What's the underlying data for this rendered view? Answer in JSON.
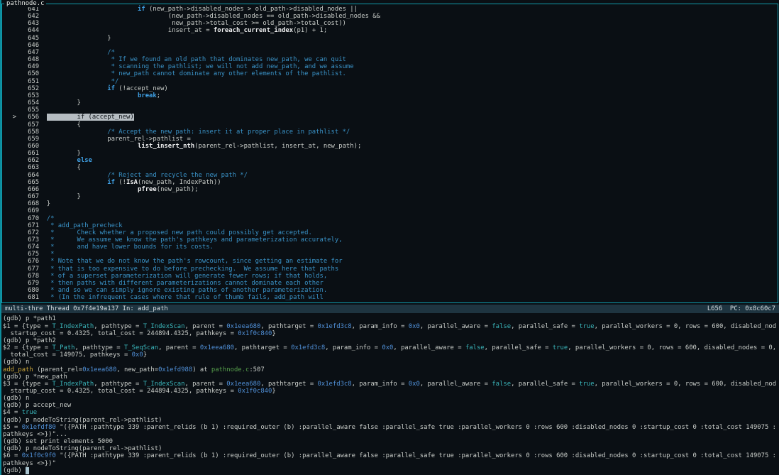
{
  "window": {
    "title": "pathnode.c"
  },
  "status": {
    "left": "multi-thre Thread 0x7f4e19a137 In: add_path",
    "right": "L656  PC: 0x8c60c7"
  },
  "colors": {
    "border_teal": "#109aab",
    "comment_blue": "#3a93c8",
    "keyword_blue": "#3fa0e4",
    "address_blue": "#5090d8",
    "enum_cyan": "#3ab5ba",
    "function_yellow": "#c9a43a",
    "filename_green": "#57a04c",
    "current_line_highlight_bg": "#b6bdc2",
    "status_bar_bg": "#1e3440",
    "cursor": "#a9c4d0"
  },
  "source": {
    "current_line": "656",
    "lines": [
      {
        "num": "641",
        "code": "                        if (new_path->disabled_nodes > old_path->disabled_nodes ||"
      },
      {
        "num": "642",
        "code": "                                (new_path->disabled_nodes == old_path->disabled_nodes &&"
      },
      {
        "num": "643",
        "code": "                                 new_path->total_cost >= old_path->total_cost))"
      },
      {
        "num": "644",
        "code": "                                insert_at = foreach_current_index(p1) + 1;"
      },
      {
        "num": "645",
        "code": "                }"
      },
      {
        "num": "646",
        "code": ""
      },
      {
        "num": "647",
        "code": "                /*",
        "comment": true
      },
      {
        "num": "648",
        "code": "                 * If we found an old path that dominates new_path, we can quit",
        "comment": true
      },
      {
        "num": "649",
        "code": "                 * scanning the pathlist; we will not add new_path, and we assume",
        "comment": true
      },
      {
        "num": "650",
        "code": "                 * new_path cannot dominate any other elements of the pathlist.",
        "comment": true
      },
      {
        "num": "651",
        "code": "                 */",
        "comment": true
      },
      {
        "num": "652",
        "code": "                if (!accept_new)"
      },
      {
        "num": "653",
        "code": "                        break;"
      },
      {
        "num": "654",
        "code": "        }"
      },
      {
        "num": "655",
        "code": ""
      },
      {
        "num": "656",
        "code": "        if (accept_new)",
        "current": true
      },
      {
        "num": "657",
        "code": "        {"
      },
      {
        "num": "658",
        "code": "                /* Accept the new path: insert it at proper place in pathlist */",
        "comment": true
      },
      {
        "num": "659",
        "code": "                parent_rel->pathlist ="
      },
      {
        "num": "660",
        "code": "                        list_insert_nth(parent_rel->pathlist, insert_at, new_path);"
      },
      {
        "num": "661",
        "code": "        }"
      },
      {
        "num": "662",
        "code": "        else"
      },
      {
        "num": "663",
        "code": "        {"
      },
      {
        "num": "664",
        "code": "                /* Reject and recycle the new path */",
        "comment": true
      },
      {
        "num": "665",
        "code": "                if (!IsA(new_path, IndexPath))"
      },
      {
        "num": "666",
        "code": "                        pfree(new_path);"
      },
      {
        "num": "667",
        "code": "        }"
      },
      {
        "num": "668",
        "code": "}"
      },
      {
        "num": "669",
        "code": ""
      },
      {
        "num": "670",
        "code": "/*",
        "comment": true
      },
      {
        "num": "671",
        "code": " * add_path_precheck",
        "comment": true
      },
      {
        "num": "672",
        "code": " *      Check whether a proposed new path could possibly get accepted.",
        "comment": true
      },
      {
        "num": "673",
        "code": " *      We assume we know the path's pathkeys and parameterization accurately,",
        "comment": true
      },
      {
        "num": "674",
        "code": " *      and have lower bounds for its costs.",
        "comment": true
      },
      {
        "num": "675",
        "code": " *",
        "comment": true
      },
      {
        "num": "676",
        "code": " * Note that we do not know the path's rowcount, since getting an estimate for",
        "comment": true
      },
      {
        "num": "677",
        "code": " * that is too expensive to do before prechecking.  We assume here that paths",
        "comment": true
      },
      {
        "num": "678",
        "code": " * of a superset parameterization will generate fewer rows; if that holds,",
        "comment": true
      },
      {
        "num": "679",
        "code": " * then paths with different parameterizations cannot dominate each other",
        "comment": true
      },
      {
        "num": "680",
        "code": " * and so we can simply ignore existing paths of another parameterization.",
        "comment": true
      },
      {
        "num": "681",
        "code": " * (In the infrequent cases where that rule of thumb fails, add_path will",
        "comment": true
      }
    ]
  },
  "gdb": {
    "lines": [
      [
        [
          "p",
          "(gdb) p *path1"
        ]
      ],
      [
        [
          "p",
          "$1 = {type = "
        ],
        [
          "cy",
          "T_IndexPath"
        ],
        [
          "p",
          ", pathtype = "
        ],
        [
          "cy",
          "T_IndexScan"
        ],
        [
          "p",
          ", parent = "
        ],
        [
          "addr",
          "0x1eea680"
        ],
        [
          "p",
          ", pathtarget = "
        ],
        [
          "addr",
          "0x1efd3c8"
        ],
        [
          "p",
          ", param_info = "
        ],
        [
          "addr",
          "0x0"
        ],
        [
          "p",
          ", parallel_aware = "
        ],
        [
          "cy",
          "false"
        ],
        [
          "p",
          ", parallel_safe = "
        ],
        [
          "cy",
          "true"
        ],
        [
          "p",
          ", parallel_workers = 0, rows = 600, disabled_nod"
        ]
      ],
      [
        [
          "p",
          "  startup_cost = 0.4325, total_cost = 244894.4325, pathkeys = "
        ],
        [
          "addr",
          "0x1f0c840"
        ],
        [
          "p",
          "}"
        ]
      ],
      [
        [
          "p",
          "(gdb) p *path2"
        ]
      ],
      [
        [
          "p",
          "$2 = {type = "
        ],
        [
          "cy",
          "T_Path"
        ],
        [
          "p",
          ", pathtype = "
        ],
        [
          "cy",
          "T_SeqScan"
        ],
        [
          "p",
          ", parent = "
        ],
        [
          "addr",
          "0x1eea680"
        ],
        [
          "p",
          ", pathtarget = "
        ],
        [
          "addr",
          "0x1efd3c8"
        ],
        [
          "p",
          ", param_info = "
        ],
        [
          "addr",
          "0x0"
        ],
        [
          "p",
          ", parallel_aware = "
        ],
        [
          "cy",
          "false"
        ],
        [
          "p",
          ", parallel_safe = "
        ],
        [
          "cy",
          "true"
        ],
        [
          "p",
          ", parallel_workers = 0, rows = 600, disabled_nodes = 0,"
        ]
      ],
      [
        [
          "p",
          "  total_cost = 149075, pathkeys = "
        ],
        [
          "addr",
          "0x0"
        ],
        [
          "p",
          "}"
        ]
      ],
      [
        [
          "p",
          "(gdb) n"
        ]
      ],
      [
        [
          "fny",
          "add_path"
        ],
        [
          "p",
          " (parent_rel="
        ],
        [
          "addr",
          "0x1eea680"
        ],
        [
          "p",
          ", new_path="
        ],
        [
          "addr",
          "0x1efd988"
        ],
        [
          "p",
          ") at "
        ],
        [
          "fil",
          "pathnode.c"
        ],
        [
          "p",
          ":507"
        ]
      ],
      [
        [
          "p",
          "(gdb) p *new_path"
        ]
      ],
      [
        [
          "p",
          "$3 = {type = "
        ],
        [
          "cy",
          "T_IndexPath"
        ],
        [
          "p",
          ", pathtype = "
        ],
        [
          "cy",
          "T_IndexScan"
        ],
        [
          "p",
          ", parent = "
        ],
        [
          "addr",
          "0x1eea680"
        ],
        [
          "p",
          ", pathtarget = "
        ],
        [
          "addr",
          "0x1efd3c8"
        ],
        [
          "p",
          ", param_info = "
        ],
        [
          "addr",
          "0x0"
        ],
        [
          "p",
          ", parallel_aware = "
        ],
        [
          "cy",
          "false"
        ],
        [
          "p",
          ", parallel_safe = "
        ],
        [
          "cy",
          "true"
        ],
        [
          "p",
          ", parallel_workers = 0, rows = 600, disabled_nod"
        ]
      ],
      [
        [
          "p",
          "  startup_cost = 0.4325, total_cost = 244894.4325, pathkeys = "
        ],
        [
          "addr",
          "0x1f0c840"
        ],
        [
          "p",
          "}"
        ]
      ],
      [
        [
          "p",
          "(gdb) n"
        ]
      ],
      [
        [
          "p",
          "(gdb) p accept_new"
        ]
      ],
      [
        [
          "p",
          "$4 = "
        ],
        [
          "cy",
          "true"
        ]
      ],
      [
        [
          "p",
          "(gdb) p nodeToString(parent_rel->pathlist)"
        ]
      ],
      [
        [
          "p",
          "$5 = "
        ],
        [
          "addr",
          "0x1efdf80"
        ],
        [
          "p",
          " \"({PATH :pathtype 339 :parent_relids (b 1) :required_outer (b) :parallel_aware false :parallel_safe true :parallel_workers 0 :rows 600 :disabled_nodes 0 :startup_cost 0 :total_cost 149075 :"
        ]
      ],
      [
        [
          "p",
          "pathkeys <>})\"..."
        ]
      ],
      [
        [
          "p",
          "(gdb) set print elements 5000"
        ]
      ],
      [
        [
          "p",
          "(gdb) p nodeToString(parent_rel->pathlist)"
        ]
      ],
      [
        [
          "p",
          "$6 = "
        ],
        [
          "addr",
          "0x1f0c9f0"
        ],
        [
          "p",
          " \"({PATH :pathtype 339 :parent_relids (b 1) :required_outer (b) :parallel_aware false :parallel_safe true :parallel_workers 0 :rows 600 :disabled_nodes 0 :startup_cost 0 :total_cost 149075 :"
        ]
      ],
      [
        [
          "p",
          "pathkeys <>})\""
        ]
      ],
      [
        [
          "p",
          "(gdb) "
        ],
        [
          "cur",
          " "
        ]
      ]
    ]
  }
}
